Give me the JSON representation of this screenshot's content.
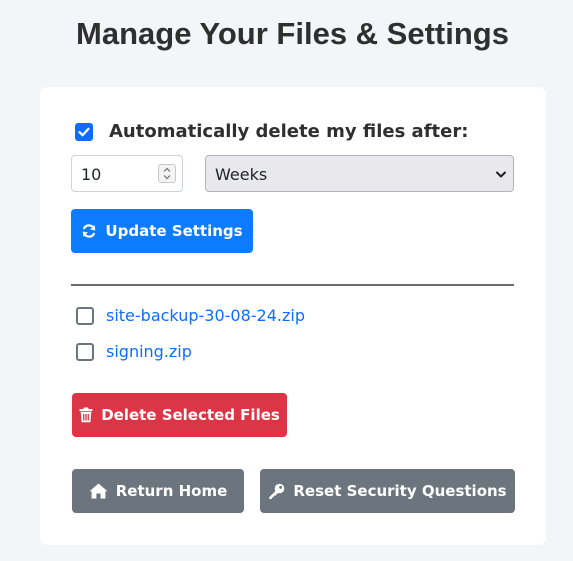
{
  "page": {
    "title": "Manage Your Files & Settings"
  },
  "settings": {
    "auto_delete_label": "Automatically delete my files after:",
    "auto_delete_checked": true,
    "duration_value": "10",
    "unit_selected": "Weeks",
    "update_button_label": "Update Settings",
    "accent_color": "#0d6efd"
  },
  "files": {
    "items": [
      {
        "name": "site-backup-30-08-24.zip",
        "checked": false
      },
      {
        "name": "signing.zip",
        "checked": false
      }
    ],
    "delete_button_label": "Delete Selected Files",
    "delete_color": "#dc3545"
  },
  "footer": {
    "home_button_label": "Return Home",
    "reset_button_label": "Reset Security Questions",
    "button_color": "#6c757d"
  },
  "icons": {
    "update": "sync-icon",
    "delete": "trash-icon",
    "home": "home-icon",
    "reset": "key-icon"
  }
}
